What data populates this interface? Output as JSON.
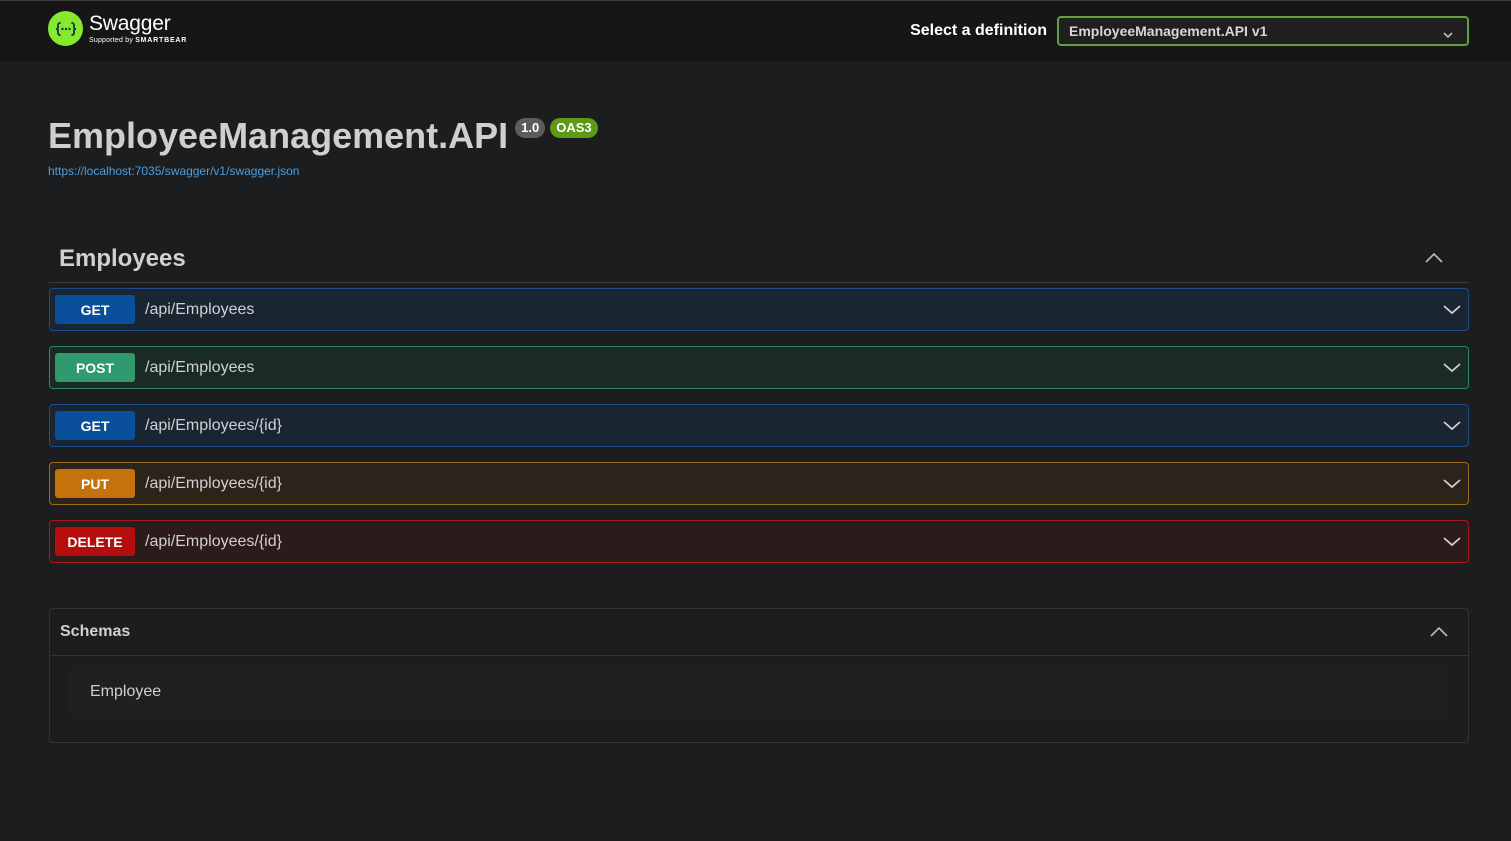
{
  "topbar": {
    "logo_name": "Swagger",
    "logo_sub_prefix": "Supported by",
    "logo_sub_brand": "SMARTBEAR",
    "definition_label": "Select a definition",
    "definition_value": "EmployeeManagement.API v1",
    "icons": [
      "swagger-logo-icon",
      "chevron-down-icon"
    ]
  },
  "info": {
    "title": "EmployeeManagement.API",
    "version_badge": "1.0",
    "oas_badge": "OAS3",
    "spec_url": "https://localhost:7035/swagger/v1/swagger.json"
  },
  "tag": {
    "name": "Employees",
    "expanded": true
  },
  "operations": [
    {
      "method": "GET",
      "path": "/api/Employees"
    },
    {
      "method": "POST",
      "path": "/api/Employees"
    },
    {
      "method": "GET",
      "path": "/api/Employees/{id}"
    },
    {
      "method": "PUT",
      "path": "/api/Employees/{id}"
    },
    {
      "method": "DELETE",
      "path": "/api/Employees/{id}"
    }
  ],
  "schemas": {
    "title": "Schemas",
    "items": [
      "Employee"
    ]
  },
  "colors": {
    "get": "#0a4f9c",
    "post": "#2e9a6e",
    "put": "#c4720b",
    "delete": "#b50d0d",
    "logo_green": "#85ea2d",
    "oas_badge": "#5c9a16",
    "link": "#4b9fe1"
  }
}
